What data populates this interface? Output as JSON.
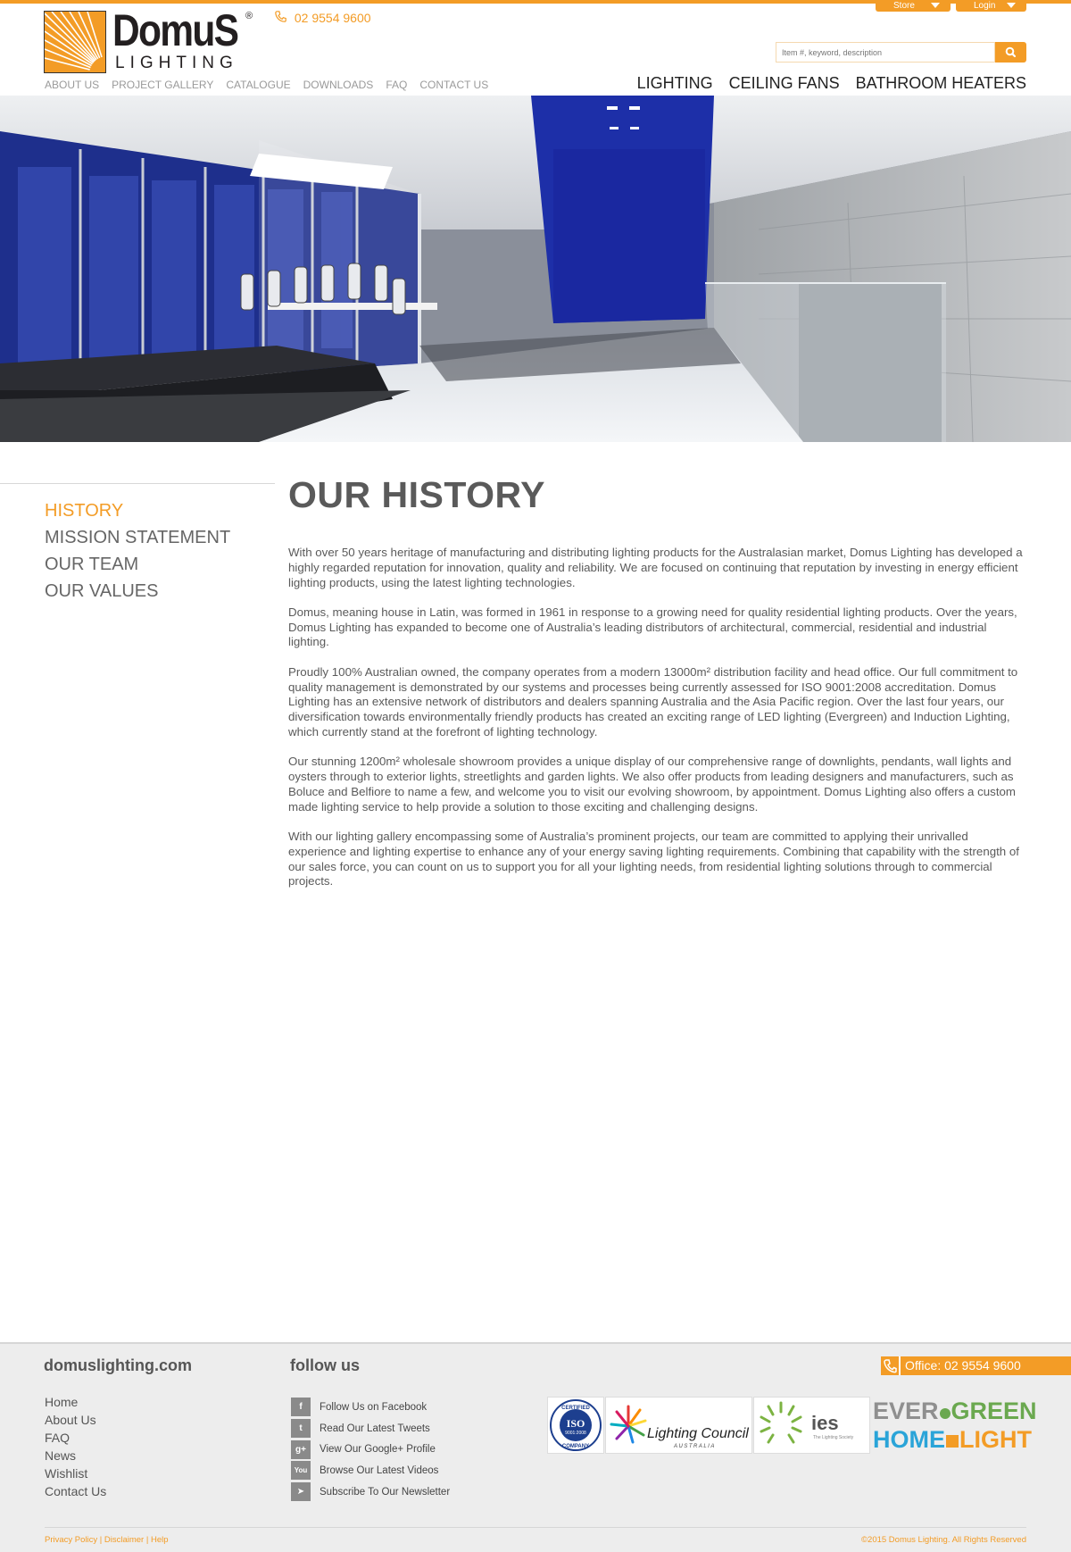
{
  "header": {
    "store_label": "Store",
    "login_label": "Login",
    "logo_word": "DomuS",
    "logo_reg": "®",
    "logo_sub": "LIGHTING",
    "phone": "02 9554 9600",
    "search_placeholder": "Item #, keyword, description",
    "subnav": [
      "ABOUT US",
      "PROJECT GALLERY",
      "CATALOGUE",
      "DOWNLOADS",
      "FAQ",
      "CONTACT US"
    ],
    "mainnav": [
      "LIGHTING",
      "CEILING FANS",
      "BATHROOM HEATERS"
    ]
  },
  "sidebar": {
    "items": [
      "HISTORY",
      "MISSION STATEMENT",
      "OUR TEAM",
      "OUR VALUES"
    ],
    "active": "HISTORY"
  },
  "main": {
    "title": "OUR HISTORY",
    "paragraphs": [
      " With over 50 years heritage of manufacturing and distributing lighting products for the Australasian market, Domus Lighting has developed a highly regarded reputation for innovation, quality and reliability. We are focused on continuing that reputation by investing in energy efficient lighting products, using the latest lighting technologies.",
      "Domus, meaning house in Latin, was formed in 1961 in response to a growing need for quality residential lighting products. Over the years, Domus Lighting has expanded to become one of Australia’s leading distributors of architectural, commercial, residential and industrial lighting.",
      "Proudly 100% Australian owned, the company operates from a modern 13000m² distribution facility and head office. Our full commitment to quality management is demonstrated by our systems and processes being currently assessed for ISO 9001:2008 accreditation. Domus Lighting has an extensive network of distributors and dealers spanning Australia and the Asia Pacific region. Over the last four years, our diversification towards environmentally friendly products has created an exciting range of LED lighting (Evergreen) and Induction Lighting, which currently stand at the forefront of lighting technology.",
      "Our stunning 1200m² wholesale showroom provides a unique display of our comprehensive range of downlights, pendants, wall lights and oysters through to exterior lights, streetlights and garden lights. We also offer products from leading designers and manufacturers, such as Boluce and Belfiore to name a few, and welcome you to visit our evolving showroom, by appointment. Domus Lighting also offers a custom made lighting service to help provide a solution to those exciting and challenging designs.",
      "With our lighting gallery encompassing some of Australia’s prominent projects, our team are committed to applying their unrivalled experience and lighting expertise to enhance any of your energy saving lighting requirements. Combining that capability with the strength of our sales force, you can count on us to support you for all your lighting needs, from residential lighting solutions through to commercial projects."
    ]
  },
  "footer": {
    "domain": "domuslighting.com",
    "links": [
      "Home",
      "About Us",
      "FAQ",
      "News",
      "Wishlist",
      "Contact Us"
    ],
    "follow_title": "follow us",
    "social": [
      {
        "icon": "facebook-icon",
        "glyph": "f",
        "label": "Follow Us on Facebook"
      },
      {
        "icon": "twitter-icon",
        "glyph": "t",
        "label": "Read Our Latest Tweets"
      },
      {
        "icon": "google-plus-icon",
        "glyph": "g+",
        "label": "View Our Google+ Profile"
      },
      {
        "icon": "youtube-icon",
        "glyph": "You",
        "label": "Browse Our Latest Videos"
      },
      {
        "icon": "newsletter-icon",
        "glyph": "➤",
        "label": "Subscribe To Our Newsletter"
      }
    ],
    "office": "Office: 02 9554 9600",
    "iso_top": "CERTIFIED",
    "iso_mid": "ISO",
    "iso_num": "9001:2008",
    "iso_bottom": "COMPANY",
    "lighting_council": "Lighting Council",
    "lighting_council_sub": "AUSTRALIA",
    "ies": "ies",
    "ies_sub": "The Lighting Society",
    "evergreen_a": "EVER",
    "evergreen_b": "GREEN",
    "homelight_a": "HOME",
    "homelight_b": "LIGHT",
    "legal": [
      "Privacy Policy",
      "Disclaimer",
      "Help"
    ],
    "copyright": "©2015 Domus Lighting. All Rights Reserved"
  },
  "colors": {
    "accent": "#f39c26",
    "text": "#5a5a5a",
    "evergreen_grey": "#8f8f8f",
    "evergreen_green": "#6aa84f",
    "homelight_blue": "#2aa4d8"
  }
}
